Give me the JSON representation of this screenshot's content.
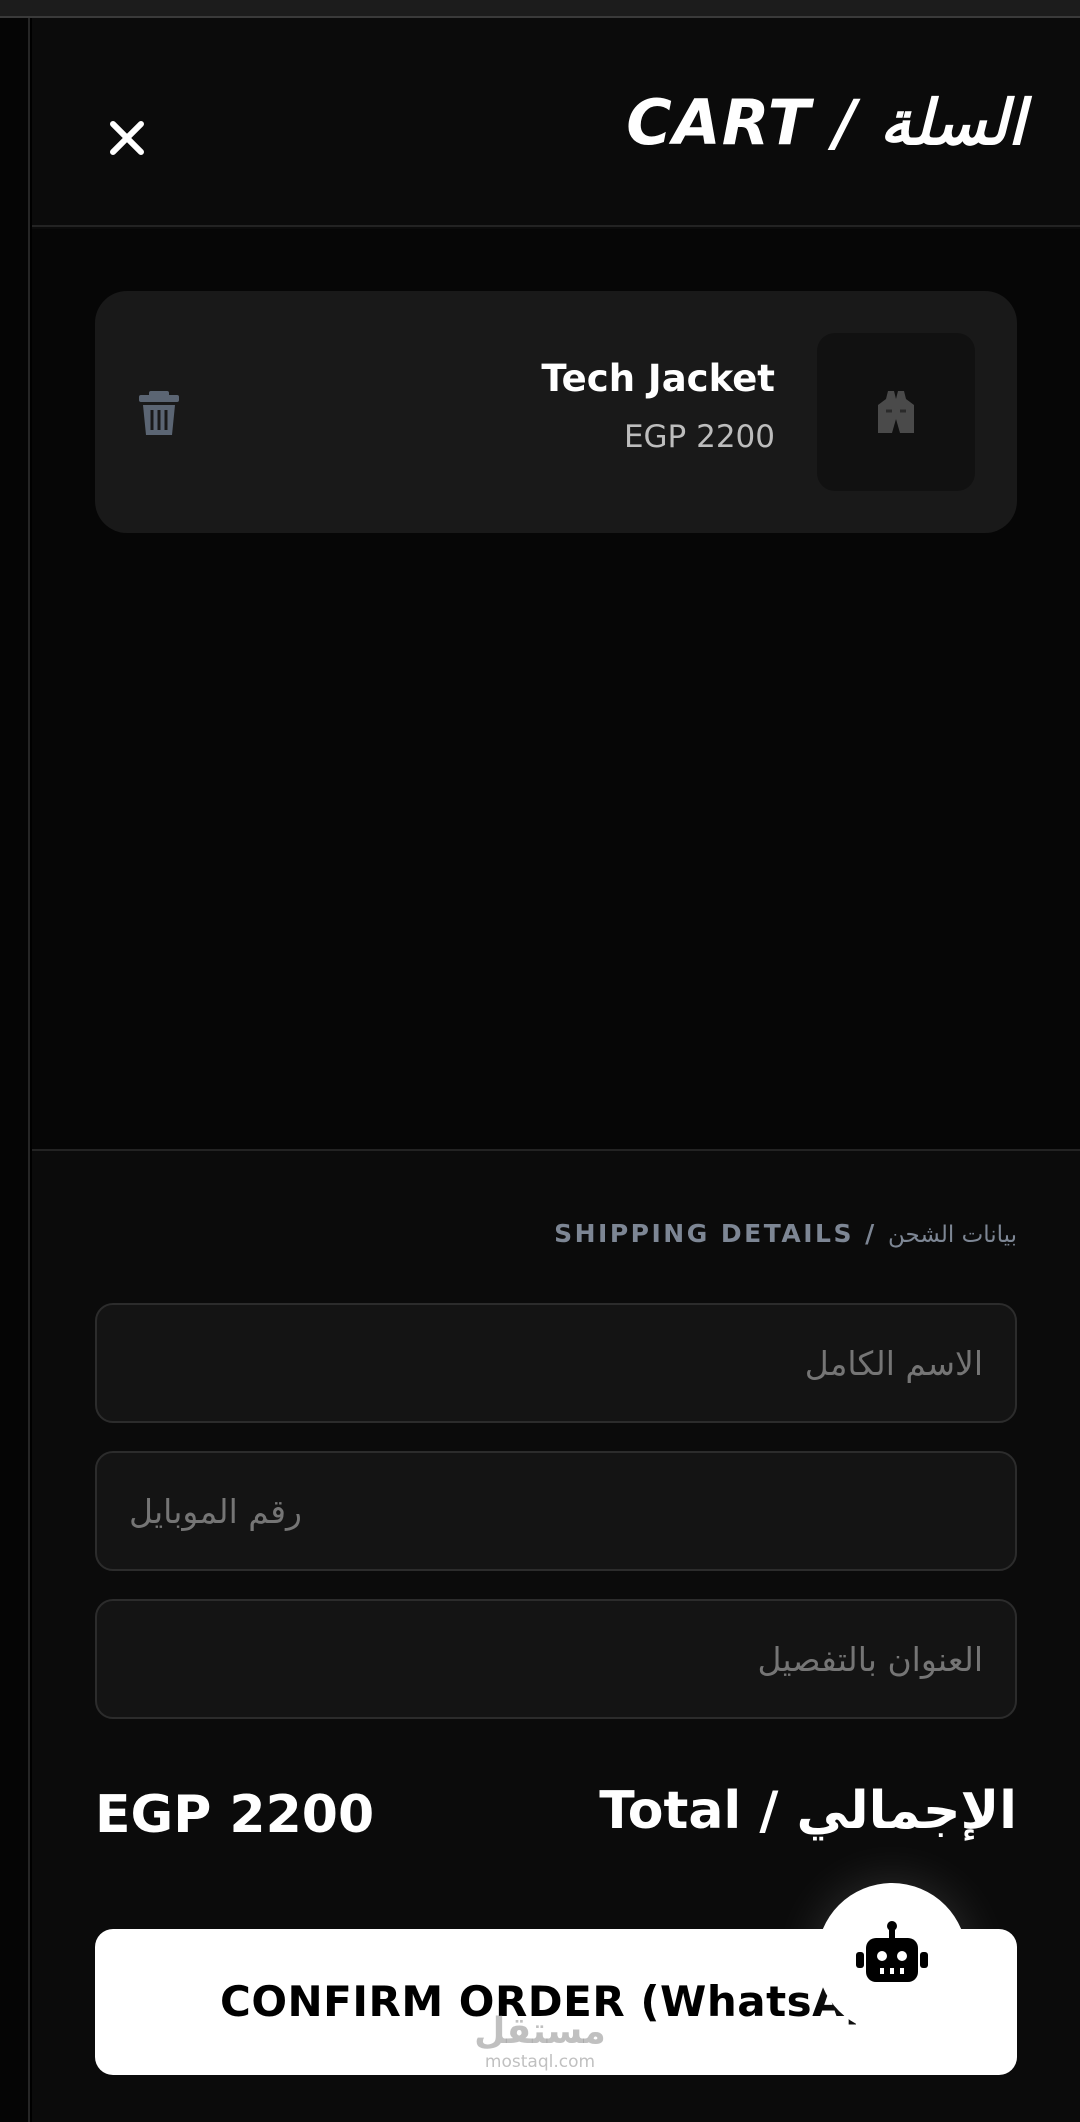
{
  "header": {
    "title": "CART / السلة",
    "close_icon": "close-icon"
  },
  "cart": {
    "items": [
      {
        "name": "Tech Jacket",
        "price": "EGP 2200",
        "thumbnail_icon": "vest-icon",
        "remove_icon": "trash-icon"
      }
    ]
  },
  "shipping": {
    "title_en": "SHIPPING DETAILS",
    "title_sep": " / ",
    "title_ar": "بيانات الشحن",
    "fields": [
      {
        "placeholder": "الاسم الكامل",
        "value": ""
      },
      {
        "placeholder": "رقم الموبايل",
        "value": ""
      },
      {
        "placeholder": "العنوان بالتفصيل",
        "value": ""
      }
    ]
  },
  "summary": {
    "total_label": "Total / الإجمالي",
    "total_amount": "EGP 2200"
  },
  "confirm_button": {
    "label": "CONFIRM ORDER (WhatsApp)"
  },
  "chat_bot": {
    "icon": "robot-icon"
  },
  "watermark": {
    "arabic": "مستقل",
    "latin": "mostaql.com"
  },
  "colors": {
    "background": "#0b0b0b",
    "card": "#191919",
    "muted_text": "#7d8694",
    "button": "#ffffff"
  }
}
